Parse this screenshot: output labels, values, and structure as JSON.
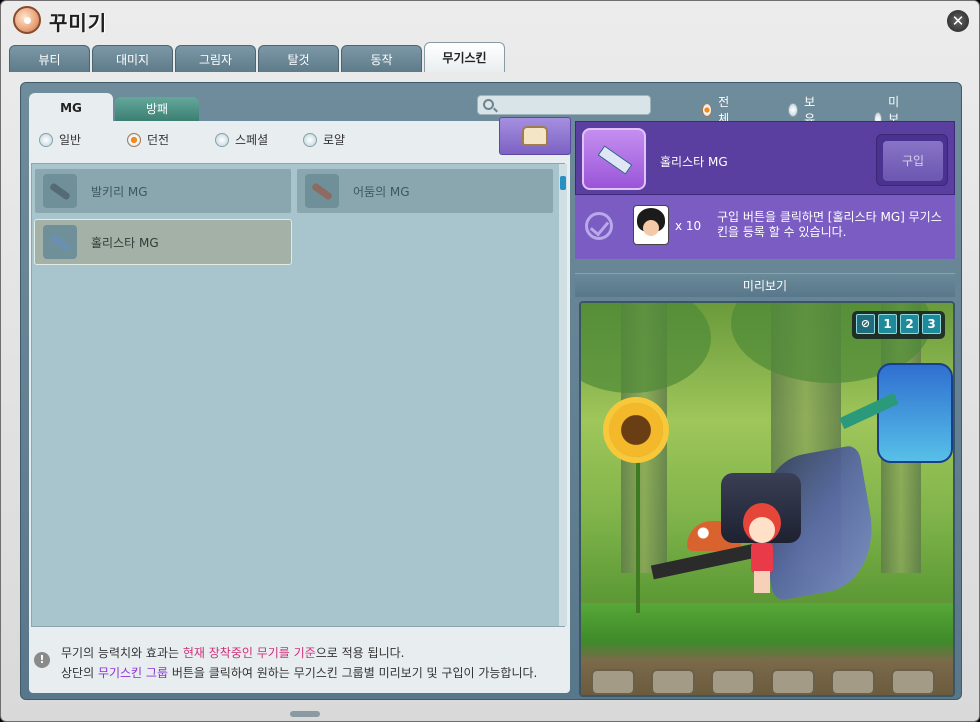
{
  "window": {
    "title": "꾸미기"
  },
  "top_tabs": [
    {
      "label": "뷰티",
      "active": false
    },
    {
      "label": "대미지",
      "active": false
    },
    {
      "label": "그림자",
      "active": false
    },
    {
      "label": "탈것",
      "active": false
    },
    {
      "label": "동작",
      "active": false
    },
    {
      "label": "무기스킨",
      "active": true
    }
  ],
  "sub_tabs": [
    {
      "label": "MG",
      "active": true
    },
    {
      "label": "방패",
      "active": false
    }
  ],
  "grade_filters": [
    {
      "label": "일반",
      "selected": false
    },
    {
      "label": "던전",
      "selected": true
    },
    {
      "label": "스페셜",
      "selected": false
    },
    {
      "label": "로얄",
      "selected": false
    }
  ],
  "search": {
    "placeholder": "",
    "value": ""
  },
  "ownership_filters": [
    {
      "label": "전체",
      "selected": true
    },
    {
      "label": "보유",
      "selected": false
    },
    {
      "label": "미보유",
      "selected": false
    }
  ],
  "skin_list": [
    {
      "name": "발키리 MG",
      "selected": false,
      "icon": "valkyrie-mg-icon"
    },
    {
      "name": "어둠의 MG",
      "selected": false,
      "icon": "darkness-mg-icon"
    },
    {
      "name": "홀리스타 MG",
      "selected": true,
      "icon": "holystar-mg-icon"
    }
  ],
  "selected_item": {
    "name": "홀리스타 MG",
    "buy_label": "구입"
  },
  "requirement": {
    "count": "x 10",
    "text": "구입 버튼을 클릭하면 [홀리스타 MG] 무기스킨을 등록 할 수 있습니다."
  },
  "preview": {
    "title": "미리보기",
    "poses": [
      "1",
      "2",
      "3"
    ]
  },
  "notice": {
    "line1_prefix": "무기의 능력치와 효과는 ",
    "line1_highlight": "현재 장착중인 무기를 기준",
    "line1_suffix": "으로 적용 됩니다.",
    "line2_prefix": "상단의 ",
    "line2_highlight": "무기스킨 그룹",
    "line2_suffix": " 버튼을 클릭하여 원하는 무기스킨 그룹별 미리보기 및 구입이 가능합니다."
  },
  "colors": {
    "accent_purple": "#5a3fa0",
    "radio_selected": "#f08a25",
    "highlight_pink": "#d02f7a",
    "highlight_purple": "#8c32d6"
  }
}
